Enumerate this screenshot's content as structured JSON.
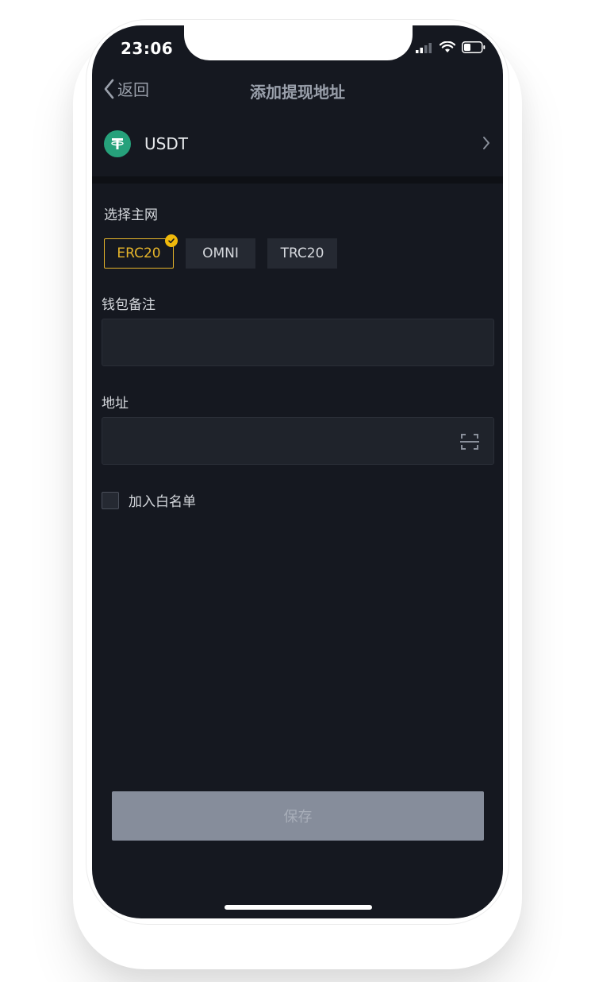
{
  "status_bar": {
    "time": "23:06"
  },
  "nav": {
    "back_label": "返回",
    "title": "添加提现地址"
  },
  "coin": {
    "symbol": "USDT",
    "icon": "tether-icon",
    "icon_color": "#26a17b"
  },
  "network": {
    "label": "选择主网",
    "options": [
      "ERC20",
      "OMNI",
      "TRC20"
    ],
    "selected": "ERC20",
    "accent_color": "#e5b42a"
  },
  "wallet_note": {
    "label": "钱包备注",
    "value": "",
    "placeholder": ""
  },
  "address": {
    "label": "地址",
    "value": "",
    "placeholder": "",
    "scan_icon": "scan-icon"
  },
  "whitelist": {
    "label": "加入白名单",
    "checked": false
  },
  "save_button": {
    "label": "保存",
    "enabled": false
  }
}
